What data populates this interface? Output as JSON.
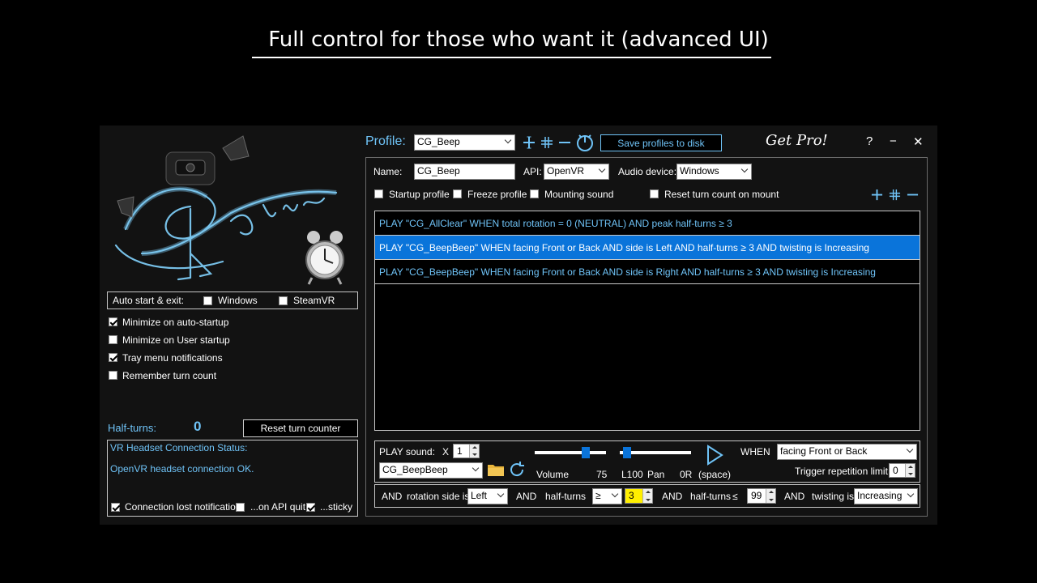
{
  "banner": {
    "title": "Full control for those who want it (advanced UI)"
  },
  "left": {
    "autostart": {
      "label": "Auto start & exit:",
      "windows_label": "Windows",
      "windows_checked": false,
      "steamvr_label": "SteamVR",
      "steamvr_checked": false
    },
    "options": [
      {
        "label": "Minimize on auto-startup",
        "checked": true
      },
      {
        "label": "Minimize on User startup",
        "checked": false
      },
      {
        "label": "Tray menu notifications",
        "checked": true
      },
      {
        "label": "Remember turn count",
        "checked": false
      }
    ],
    "half_turns_label": "Half-turns:",
    "half_turns_value": "0",
    "reset_button": "Reset turn counter",
    "status": {
      "title": "VR Headset Connection Status:",
      "message": "OpenVR headset connection OK.",
      "connection_lost_label": "Connection lost notification",
      "connection_lost_checked": true,
      "api_quit_label": "...on API quit",
      "api_quit_checked": false,
      "sticky_label": "...sticky",
      "sticky_checked": true
    }
  },
  "header": {
    "profile_label": "Profile:",
    "profile_value": "CG_Beep",
    "save_button": "Save profiles to disk",
    "get_pro": "Get Pro!",
    "help": "?",
    "minimize": "−",
    "close": "✕"
  },
  "profile": {
    "name_label": "Name:",
    "name_value": "CG_Beep",
    "api_label": "API:",
    "api_value": "OpenVR",
    "audio_label": "Audio device:",
    "audio_value": "Windows",
    "startup_label": "Startup profile",
    "freeze_label": "Freeze profile",
    "mounting_label": "Mounting sound",
    "reset_mount_label": "Reset turn count on mount"
  },
  "rules": [
    {
      "text": "PLAY \"CG_AllClear\" WHEN total rotation = 0  (NEUTRAL) AND peak half-turns ≥ 3",
      "selected": false
    },
    {
      "text": "PLAY \"CG_BeepBeep\" WHEN facing Front or Back AND side is Left AND half-turns ≥ 3 AND twisting is Increasing",
      "selected": true
    },
    {
      "text": "PLAY \"CG_BeepBeep\" WHEN facing Front or Back AND side is Right AND half-turns ≥ 3 AND twisting is Increasing",
      "selected": false
    }
  ],
  "play": {
    "label": "PLAY sound:",
    "x_label": "X",
    "x_value": "1",
    "sound_value": "CG_BeepBeep",
    "volume_label": "Volume",
    "volume_value": "75",
    "volume_level": 0.72,
    "pan_left": "L100",
    "pan_label": "Pan",
    "pan_right": "0R",
    "pan_level": 0.1,
    "space_label": "(space)",
    "when_label": "WHEN",
    "when_value": "facing Front or Back",
    "trigger_label": "Trigger repetition limit =",
    "trigger_value": "0"
  },
  "cond": {
    "and1": "AND",
    "rotation_label": "rotation side is",
    "rotation_value": "Left",
    "and2": "AND",
    "half_label": "half-turns",
    "op1": "≥",
    "val1": "3",
    "and3": "AND",
    "half2_label": "half-turns",
    "le": "≤",
    "val2": "99",
    "and4": "AND",
    "twist_label": "twisting is",
    "twist_value": "Increasing"
  }
}
